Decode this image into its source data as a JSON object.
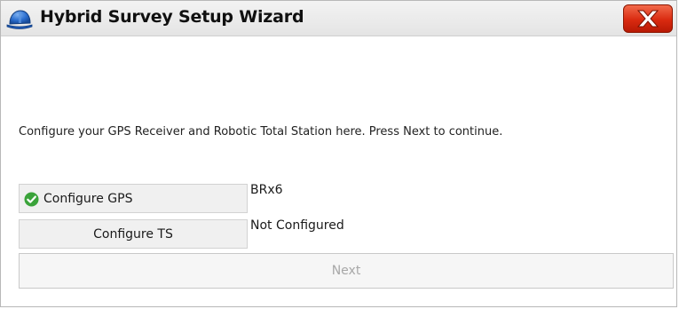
{
  "window": {
    "title": "Hybrid Survey Setup Wizard",
    "app_icon": "hard-hat-icon",
    "close_icon": "close-x-icon",
    "close_color": "#d92a10"
  },
  "instruction": "Configure your GPS Receiver and Robotic Total Station here. Press Next to continue.",
  "devices": [
    {
      "button_label": "Configure GPS",
      "status": "BRx6",
      "configured": true,
      "status_icon": "check-circle-icon",
      "status_icon_color": "#3aa33a"
    },
    {
      "button_label": "Configure TS",
      "status": "Not Configured",
      "configured": false
    }
  ],
  "next_button": {
    "label": "Next",
    "enabled": false
  }
}
